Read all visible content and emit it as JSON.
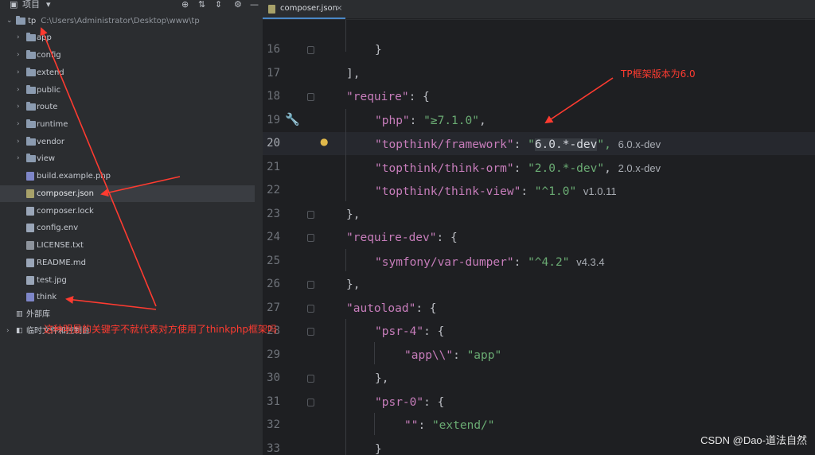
{
  "project_panel": {
    "title": "项目",
    "root": {
      "name": "tp",
      "path": "C:\\Users\\Administrator\\Desktop\\www\\tp"
    },
    "folders": [
      "app",
      "config",
      "extend",
      "public",
      "route",
      "runtime",
      "vendor",
      "view"
    ],
    "files": [
      "build.example.php",
      "composer.json",
      "composer.lock",
      "config.env",
      "LICENSE.txt",
      "README.md",
      "test.jpg",
      "think"
    ],
    "selected": "composer.json",
    "external_libraries": "外部库",
    "scratches": "临时文件和控制台"
  },
  "tab": {
    "label": "composer.json",
    "close": "×"
  },
  "editor": {
    "line_numbers": [
      "16",
      "17",
      "18",
      "19",
      "20",
      "21",
      "22",
      "23",
      "24",
      "25",
      "26",
      "27",
      "28",
      "29",
      "30",
      "31",
      "32",
      "33"
    ],
    "lines": {
      "l16": "}",
      "l17": "],",
      "l18_key": "\"require\"",
      "l18_rest": ": {",
      "l19_key": "\"php\"",
      "l19_sep": ": ",
      "l19_val": "\"≥7.1.0\"",
      "l19_end": ",",
      "l20_key": "\"topthink/framework\"",
      "l20_sep": ": ",
      "l20_q": "\"",
      "l20_val": "6.0.*-dev",
      "l20_end": "\",",
      "l20_hint": "6.0.x-dev",
      "l21_key": "\"topthink/think-orm\"",
      "l21_sep": ": ",
      "l21_val": "\"2.0.*-dev\"",
      "l21_end": ",",
      "l21_hint": "2.0.x-dev",
      "l22_key": "\"topthink/think-view\"",
      "l22_sep": ": ",
      "l22_val": "\"^1.0\"",
      "l22_hint": "v1.0.11",
      "l23": "},",
      "l24_key": "\"require-dev\"",
      "l24_rest": ": {",
      "l25_key": "\"symfony/var-dumper\"",
      "l25_sep": ": ",
      "l25_val": "\"^4.2\"",
      "l25_hint": "v4.3.4",
      "l26": "},",
      "l27_key": "\"autoload\"",
      "l27_rest": ": {",
      "l28_key": "\"psr-4\"",
      "l28_rest": ": {",
      "l29_key": "\"app\\\\\"",
      "l29_sep": ": ",
      "l29_val": "\"app\"",
      "l30": "},",
      "l31_key": "\"psr-0\"",
      "l31_rest": ": {",
      "l32_key": "\"\"",
      "l32_sep": ": ",
      "l32_val": "\"extend/\"",
      "l33": "}"
    }
  },
  "annotations": {
    "version_note": "TP框架版本为6.0",
    "keyword_note": "这种明显的关键字不就代表对方使用了thinkphp框架吗",
    "arrow_color": "#ff3b30"
  },
  "watermark": "CSDN @Dao-道法自然",
  "colors": {
    "keyword": "#c77dbb",
    "string": "#6aab73",
    "punct": "#bcbec4",
    "editor_bg": "#1e1f22",
    "panel_bg": "#2b2d30"
  }
}
